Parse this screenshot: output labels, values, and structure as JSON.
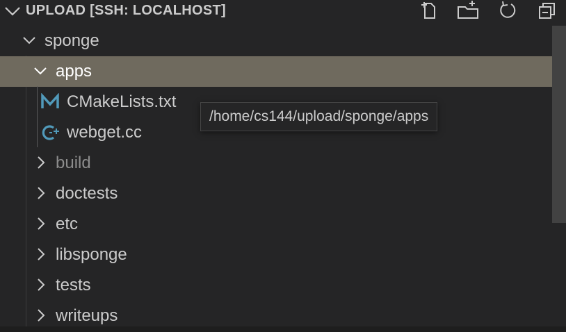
{
  "header": {
    "title": "UPLOAD [SSH: LOCALHOST]",
    "actions": [
      {
        "icon": "new-file-icon"
      },
      {
        "icon": "new-folder-icon"
      },
      {
        "icon": "refresh-icon"
      },
      {
        "icon": "collapse-all-icon"
      }
    ]
  },
  "tree": {
    "root": {
      "label": "sponge",
      "expanded": true
    },
    "apps": {
      "label": "apps",
      "expanded": true,
      "selected": true
    },
    "files": [
      {
        "label": "CMakeLists.txt",
        "icon": "cmake-icon",
        "icon_glyph": "M",
        "icon_color": "#519aba"
      },
      {
        "label": "webget.cc",
        "icon": "cpp-icon",
        "icon_glyph": "G",
        "icon_color": "#519aba"
      }
    ],
    "folders": [
      {
        "label": "build",
        "dimmed": true
      },
      {
        "label": "doctests"
      },
      {
        "label": "etc"
      },
      {
        "label": "libsponge"
      },
      {
        "label": "tests"
      },
      {
        "label": "writeups"
      }
    ]
  },
  "tooltip": {
    "text": "/home/cs144/upload/sponge/apps"
  },
  "colors": {
    "background": "#252526",
    "selection": "#6f6a5e",
    "text": "#cccccc",
    "dimmed_text": "#8c8c8c",
    "file_icon": "#519aba"
  }
}
